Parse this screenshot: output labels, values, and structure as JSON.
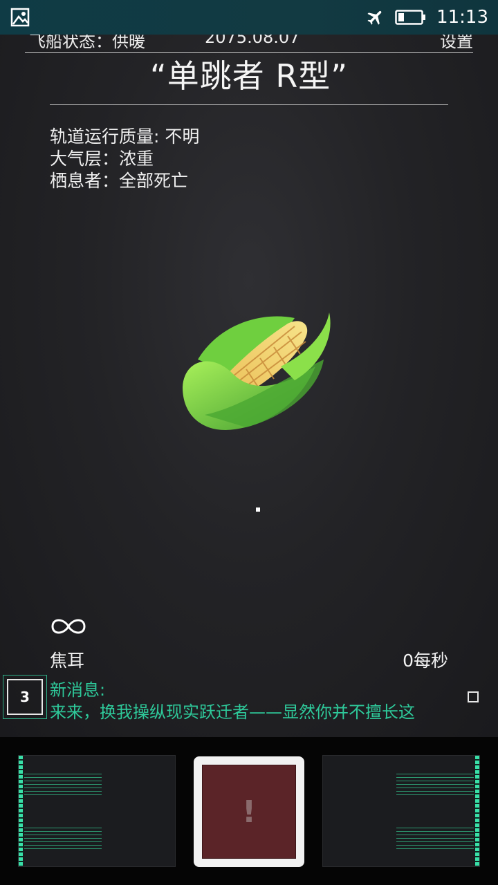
{
  "status_bar": {
    "time": "11:13",
    "left_icon": "image-icon",
    "right_icons": [
      "airplane-icon",
      "battery-icon"
    ]
  },
  "top_info": {
    "ship_status": "飞船状态：供暖",
    "date": "2075.08.07",
    "settings": "设置"
  },
  "title": "“单跳者 R型”",
  "planet_props": [
    "轨道运行质量: 不明",
    "大气层：浓重",
    "栖息者：全部死亡"
  ],
  "planet_image": "corn-icon",
  "resource": {
    "amount_symbol": "infinity-icon",
    "name": "焦耳",
    "rate": "0每秒"
  },
  "messages": {
    "count": "3",
    "header": "新消息:",
    "body": "来来，换我操纵现实跃迁者——显然你并不擅长这"
  },
  "bottom_bar": {
    "center_button_glyph": "!"
  },
  "colors": {
    "accent_green": "#2ec99a",
    "status_bar": "#0f3b45",
    "alert_button": "#5b2428"
  }
}
